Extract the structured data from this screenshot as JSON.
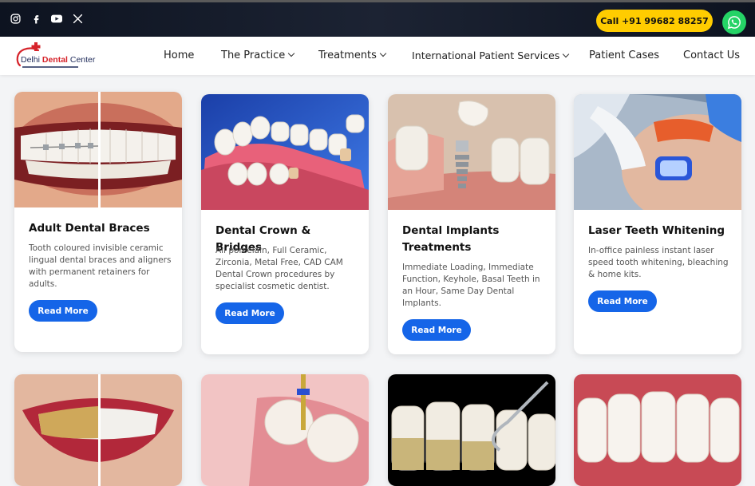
{
  "topbar": {
    "social_icons": [
      "instagram-icon",
      "facebook-icon",
      "youtube-icon",
      "x-icon"
    ],
    "call_label": "Call +91 99682 88257",
    "whatsapp_icon": "whatsapp-icon"
  },
  "logo": {
    "part1": "Delhi ",
    "part2": "Dental",
    "part3": " Center"
  },
  "nav": {
    "items": [
      {
        "label": "Home",
        "dropdown": false
      },
      {
        "label": "The Practice",
        "dropdown": true
      },
      {
        "label": "Treatments",
        "dropdown": true
      },
      {
        "label": "International Patient Services",
        "dropdown": true
      },
      {
        "label": "Patient Cases",
        "dropdown": false
      },
      {
        "label": "Contact Us",
        "dropdown": false
      }
    ]
  },
  "cards": [
    {
      "title": "Adult Dental Braces",
      "desc": "Tooth coloured invisible ceramic lingual dental braces and aligners with permanent retainers for adults.",
      "button": "Read More"
    },
    {
      "title": "Dental Crown & Bridges",
      "desc": "All porcelain, Full Ceramic, Zirconia, Metal Free, CAD CAM Dental Crown procedures by specialist cosmetic dentist.",
      "button": "Read More"
    },
    {
      "title": "Dental Implants Treatments",
      "desc": "Immediate Loading, Immediate Function, Keyhole, Basal Teeth in an Hour, Same Day Dental Implants.",
      "button": "Read More"
    },
    {
      "title": "Laser Teeth Whitening",
      "desc": "In-office painless instant laser speed tooth whitening, bleaching & home kits.",
      "button": "Read More"
    }
  ],
  "colors": {
    "accent_blue": "#1565e8",
    "call_yellow": "#ffcc00",
    "whatsapp_green": "#25d366",
    "brand_red": "#d6232a"
  }
}
